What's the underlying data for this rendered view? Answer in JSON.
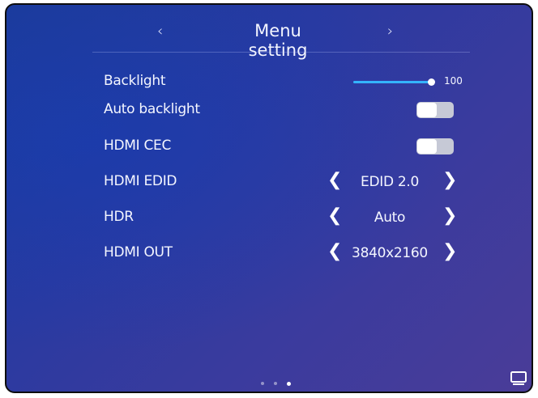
{
  "header": {
    "prev_glyph": "‹",
    "title": "Menu setting",
    "next_glyph": "›"
  },
  "rows": [
    {
      "label": "Backlight",
      "type": "slider",
      "value": "100",
      "level": 1.0
    },
    {
      "label": "Auto backlight",
      "type": "toggle",
      "state": "off"
    },
    {
      "label": "HDMI CEC",
      "type": "toggle",
      "state": "off"
    },
    {
      "label": "HDMI EDID",
      "type": "selector",
      "value": "EDID 2.0"
    },
    {
      "label": "HDR",
      "type": "selector",
      "value": "Auto"
    },
    {
      "label": "HDMI OUT",
      "type": "selector",
      "value": "3840x2160"
    }
  ],
  "selector_glyphs": {
    "left": "❮",
    "right": "❯"
  },
  "pagination": {
    "count": 3,
    "active": 3
  },
  "icons": {
    "bottom_right": "monitor-icon"
  },
  "colors": {
    "accent": "#34b4ff",
    "toggle_track": "#c6c9d6"
  }
}
